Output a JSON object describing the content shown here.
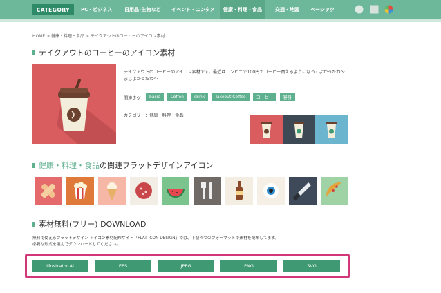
{
  "header": {
    "category_label": "CATEGORY",
    "nav_items": [
      {
        "label": "PC・ビジネス"
      },
      {
        "label": "日用品･生物など"
      },
      {
        "label": "イベント・エンタメ"
      },
      {
        "label": "健康・料理・食品"
      },
      {
        "label": "交通・地図"
      },
      {
        "label": "ベーシック"
      }
    ],
    "active_index": 3,
    "icons": [
      "circle-icon",
      "square-icon",
      "color-wheel-icon"
    ]
  },
  "breadcrumb": "HOME > 健康・料理・食品 > テイクアウトのコーヒーのアイコン素材",
  "page_title": "テイクアウトのコーヒーのアイコン素材",
  "description": "テイクアウトのコーヒーのアイコン素材です。最近はコンビニで100円でコーヒー買えるようになってよかったわ〜まじよかったわ〜",
  "tags_label": "関連タグ：",
  "tags": [
    "basic",
    "Coffee",
    "drink",
    "Takeout Coffee",
    "コーヒー",
    "容器"
  ],
  "category_line": "カテゴリー：健康・料理・食品",
  "related": {
    "title_link": "健康・料理・食品",
    "title_rest": "の関連フラットデザインアイコン",
    "icons": [
      "bandage-icon",
      "popcorn-icon",
      "ice-cream-icon",
      "salami-icon",
      "watermelon-icon",
      "fork-knife-icon",
      "beer-bottle-icon",
      "eyeball-icon",
      "knife-icon",
      "pizza-icon"
    ]
  },
  "download": {
    "title": "素材無料(フリー) DOWNLOAD",
    "desc_line1": "無料で使えるフラットデザイン アイコン素材配布サイト「FLAT ICON DESIGN」では、下記４つのフォーマットで素材を配布してます。",
    "desc_line2": "必要な形式を選んでダウンロードしてください。",
    "buttons": [
      "Illustrator Ai",
      "EPS",
      "JPEG",
      "PNG",
      "SVG"
    ]
  },
  "colors": {
    "nav_bg": "#6db79a",
    "accent": "#5fb08f",
    "button": "#3f9a74",
    "highlight_frame": "#d2377a",
    "hero_bg": "#d95c5f"
  }
}
